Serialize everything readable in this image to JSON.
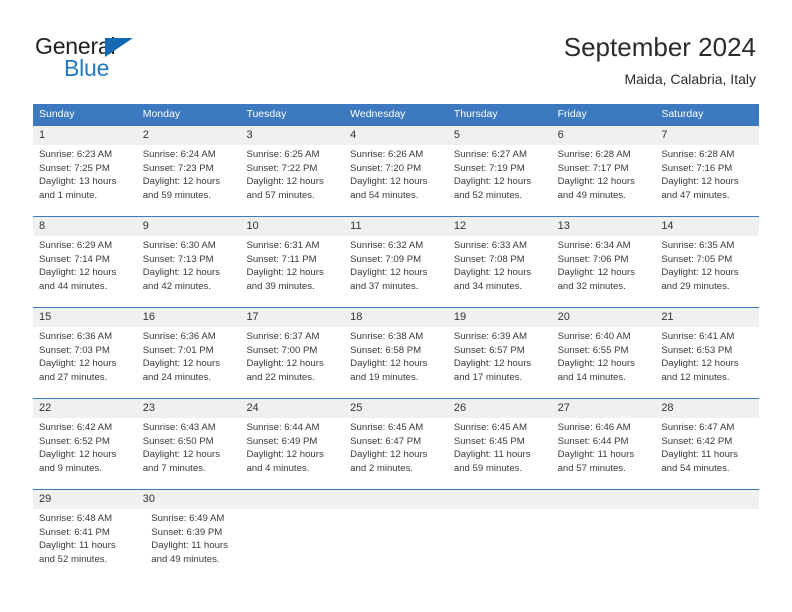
{
  "brand": {
    "name_top": "General",
    "name_bottom": "Blue",
    "triangle_color": "#1469b4",
    "text_color": "#231f20",
    "blue_text_color": "#1e7ac4"
  },
  "header": {
    "title": "September 2024",
    "subtitle": "Maida, Calabria, Italy"
  },
  "theme": {
    "header_blue": "#3c79bf",
    "daynum_band": "#f0f0f0",
    "body_text": "#3a3a3a"
  },
  "weekdays": [
    "Sunday",
    "Monday",
    "Tuesday",
    "Wednesday",
    "Thursday",
    "Friday",
    "Saturday"
  ],
  "weeks": [
    {
      "cells": [
        {
          "day": "1",
          "sunrise": "Sunrise: 6:23 AM",
          "sunset": "Sunset: 7:25 PM",
          "daylight1": "Daylight: 13 hours",
          "daylight2": "and 1 minute."
        },
        {
          "day": "2",
          "sunrise": "Sunrise: 6:24 AM",
          "sunset": "Sunset: 7:23 PM",
          "daylight1": "Daylight: 12 hours",
          "daylight2": "and 59 minutes."
        },
        {
          "day": "3",
          "sunrise": "Sunrise: 6:25 AM",
          "sunset": "Sunset: 7:22 PM",
          "daylight1": "Daylight: 12 hours",
          "daylight2": "and 57 minutes."
        },
        {
          "day": "4",
          "sunrise": "Sunrise: 6:26 AM",
          "sunset": "Sunset: 7:20 PM",
          "daylight1": "Daylight: 12 hours",
          "daylight2": "and 54 minutes."
        },
        {
          "day": "5",
          "sunrise": "Sunrise: 6:27 AM",
          "sunset": "Sunset: 7:19 PM",
          "daylight1": "Daylight: 12 hours",
          "daylight2": "and 52 minutes."
        },
        {
          "day": "6",
          "sunrise": "Sunrise: 6:28 AM",
          "sunset": "Sunset: 7:17 PM",
          "daylight1": "Daylight: 12 hours",
          "daylight2": "and 49 minutes."
        },
        {
          "day": "7",
          "sunrise": "Sunrise: 6:28 AM",
          "sunset": "Sunset: 7:16 PM",
          "daylight1": "Daylight: 12 hours",
          "daylight2": "and 47 minutes."
        }
      ]
    },
    {
      "cells": [
        {
          "day": "8",
          "sunrise": "Sunrise: 6:29 AM",
          "sunset": "Sunset: 7:14 PM",
          "daylight1": "Daylight: 12 hours",
          "daylight2": "and 44 minutes."
        },
        {
          "day": "9",
          "sunrise": "Sunrise: 6:30 AM",
          "sunset": "Sunset: 7:13 PM",
          "daylight1": "Daylight: 12 hours",
          "daylight2": "and 42 minutes."
        },
        {
          "day": "10",
          "sunrise": "Sunrise: 6:31 AM",
          "sunset": "Sunset: 7:11 PM",
          "daylight1": "Daylight: 12 hours",
          "daylight2": "and 39 minutes."
        },
        {
          "day": "11",
          "sunrise": "Sunrise: 6:32 AM",
          "sunset": "Sunset: 7:09 PM",
          "daylight1": "Daylight: 12 hours",
          "daylight2": "and 37 minutes."
        },
        {
          "day": "12",
          "sunrise": "Sunrise: 6:33 AM",
          "sunset": "Sunset: 7:08 PM",
          "daylight1": "Daylight: 12 hours",
          "daylight2": "and 34 minutes."
        },
        {
          "day": "13",
          "sunrise": "Sunrise: 6:34 AM",
          "sunset": "Sunset: 7:06 PM",
          "daylight1": "Daylight: 12 hours",
          "daylight2": "and 32 minutes."
        },
        {
          "day": "14",
          "sunrise": "Sunrise: 6:35 AM",
          "sunset": "Sunset: 7:05 PM",
          "daylight1": "Daylight: 12 hours",
          "daylight2": "and 29 minutes."
        }
      ]
    },
    {
      "cells": [
        {
          "day": "15",
          "sunrise": "Sunrise: 6:36 AM",
          "sunset": "Sunset: 7:03 PM",
          "daylight1": "Daylight: 12 hours",
          "daylight2": "and 27 minutes."
        },
        {
          "day": "16",
          "sunrise": "Sunrise: 6:36 AM",
          "sunset": "Sunset: 7:01 PM",
          "daylight1": "Daylight: 12 hours",
          "daylight2": "and 24 minutes."
        },
        {
          "day": "17",
          "sunrise": "Sunrise: 6:37 AM",
          "sunset": "Sunset: 7:00 PM",
          "daylight1": "Daylight: 12 hours",
          "daylight2": "and 22 minutes."
        },
        {
          "day": "18",
          "sunrise": "Sunrise: 6:38 AM",
          "sunset": "Sunset: 6:58 PM",
          "daylight1": "Daylight: 12 hours",
          "daylight2": "and 19 minutes."
        },
        {
          "day": "19",
          "sunrise": "Sunrise: 6:39 AM",
          "sunset": "Sunset: 6:57 PM",
          "daylight1": "Daylight: 12 hours",
          "daylight2": "and 17 minutes."
        },
        {
          "day": "20",
          "sunrise": "Sunrise: 6:40 AM",
          "sunset": "Sunset: 6:55 PM",
          "daylight1": "Daylight: 12 hours",
          "daylight2": "and 14 minutes."
        },
        {
          "day": "21",
          "sunrise": "Sunrise: 6:41 AM",
          "sunset": "Sunset: 6:53 PM",
          "daylight1": "Daylight: 12 hours",
          "daylight2": "and 12 minutes."
        }
      ]
    },
    {
      "cells": [
        {
          "day": "22",
          "sunrise": "Sunrise: 6:42 AM",
          "sunset": "Sunset: 6:52 PM",
          "daylight1": "Daylight: 12 hours",
          "daylight2": "and 9 minutes."
        },
        {
          "day": "23",
          "sunrise": "Sunrise: 6:43 AM",
          "sunset": "Sunset: 6:50 PM",
          "daylight1": "Daylight: 12 hours",
          "daylight2": "and 7 minutes."
        },
        {
          "day": "24",
          "sunrise": "Sunrise: 6:44 AM",
          "sunset": "Sunset: 6:49 PM",
          "daylight1": "Daylight: 12 hours",
          "daylight2": "and 4 minutes."
        },
        {
          "day": "25",
          "sunrise": "Sunrise: 6:45 AM",
          "sunset": "Sunset: 6:47 PM",
          "daylight1": "Daylight: 12 hours",
          "daylight2": "and 2 minutes."
        },
        {
          "day": "26",
          "sunrise": "Sunrise: 6:45 AM",
          "sunset": "Sunset: 6:45 PM",
          "daylight1": "Daylight: 11 hours",
          "daylight2": "and 59 minutes."
        },
        {
          "day": "27",
          "sunrise": "Sunrise: 6:46 AM",
          "sunset": "Sunset: 6:44 PM",
          "daylight1": "Daylight: 11 hours",
          "daylight2": "and 57 minutes."
        },
        {
          "day": "28",
          "sunrise": "Sunrise: 6:47 AM",
          "sunset": "Sunset: 6:42 PM",
          "daylight1": "Daylight: 11 hours",
          "daylight2": "and 54 minutes."
        }
      ]
    },
    {
      "cells": [
        {
          "day": "29",
          "sunrise": "Sunrise: 6:48 AM",
          "sunset": "Sunset: 6:41 PM",
          "daylight1": "Daylight: 11 hours",
          "daylight2": "and 52 minutes."
        },
        {
          "day": "30",
          "sunrise": "Sunrise: 6:49 AM",
          "sunset": "Sunset: 6:39 PM",
          "daylight1": "Daylight: 11 hours",
          "daylight2": "and 49 minutes."
        }
      ]
    }
  ]
}
